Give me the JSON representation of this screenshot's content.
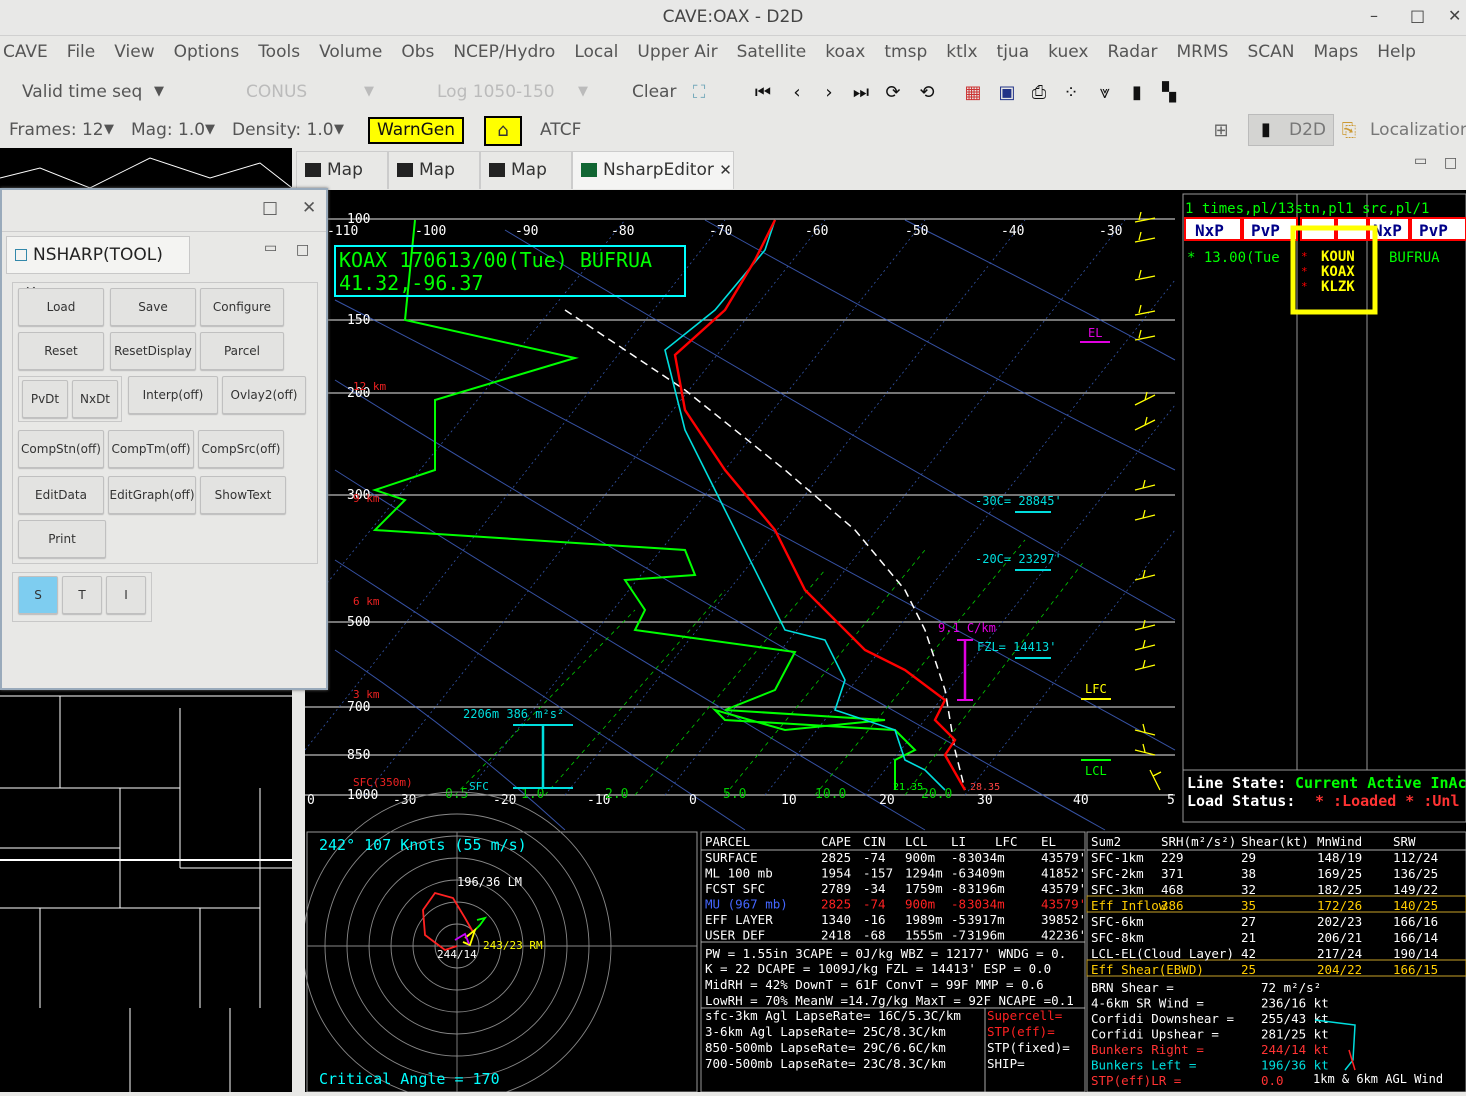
{
  "window": {
    "title": "CAVE:OAX - D2D",
    "min": "–",
    "max": "□",
    "close": "✕"
  },
  "menu": [
    "CAVE",
    "File",
    "View",
    "Options",
    "Tools",
    "Volume",
    "Obs",
    "NCEP/Hydro",
    "Local",
    "Upper Air",
    "Satellite",
    "koax",
    "tmsp",
    "ktlx",
    "tjua",
    "kuex",
    "Radar",
    "MRMS",
    "SCAN",
    "Maps",
    "Help"
  ],
  "toolbar1": {
    "valid_time": "Valid time seq",
    "conus": "CONUS",
    "log": "Log 1050-150",
    "clear": "Clear"
  },
  "toolbar2": {
    "frames": "Frames: 12",
    "mag": "Mag: 1.0",
    "density": "Density: 1.0",
    "warngen": "WarnGen",
    "atcf": "ATCF",
    "d2d": "D2D",
    "localization": "Localization"
  },
  "tabs": [
    {
      "label": "Map"
    },
    {
      "label": "Map"
    },
    {
      "label": "Map"
    },
    {
      "label": "NsharpEditor"
    }
  ],
  "tool": {
    "tab": "NSHARP(TOOL)",
    "buttons": [
      "Load",
      "Save",
      "Configure",
      "Reset",
      "ResetDisplay",
      "Parcel",
      "PvDt",
      "NxDt",
      "Interp(off)",
      "Ovlay2(off)",
      "CompStn(off)",
      "CompTm(off)",
      "CompSrc(off)",
      "EditData",
      "EditGraph(off)",
      "ShowText",
      "Print"
    ],
    "panes": [
      "S",
      "T",
      "I"
    ]
  },
  "skewt": {
    "title_line1": "KOAX 170613/00(Tue) BUFRUA",
    "title_line2": "41.32,-96.37",
    "temp_ticks": [
      "-110",
      "-100",
      "-90",
      "-80",
      "-70",
      "-60",
      "-50",
      "-40",
      "-30"
    ],
    "pressure_labels": [
      "100",
      "150",
      "200",
      "300",
      "500",
      "700",
      "850",
      "1000"
    ],
    "height_labels": [
      "12 km",
      "9 km",
      "6 km",
      "3 km",
      "SFC(350m)"
    ],
    "wind_ticks": [
      "0",
      "-30",
      "-20",
      "-10",
      "0",
      "10",
      "20",
      "30",
      "40",
      "5"
    ],
    "rh_ticks": [
      "0.5",
      "1.0",
      "2.0",
      "5.0",
      "10.0",
      "20.0"
    ],
    "annotations": {
      "el": "EL",
      "lfc": "LFC",
      "lcl": "LCL",
      "m30": "-30C= 28845'",
      "m20": "-20C= 23297'",
      "fzl": "FZL= 14413'",
      "lapse": "9.1 C/km",
      "srh": "2206m  386 m²s²",
      "sfc": "SFC",
      "t_sfc": "28.35",
      "td_sfc": "21.35"
    }
  },
  "right_panel": {
    "header": "1 times,pl/13stn,pl1 src,pl/1",
    "cols": [
      "NxP",
      "PvP",
      "NxP",
      "PvP",
      "NxP",
      "PvP"
    ],
    "time": "* 13.00(Tue",
    "stations": [
      "KOUN",
      "KOAX",
      "KLZK"
    ],
    "source": "BUFRUA",
    "line_state_label": "Line State:",
    "line_state_val": "Current Active InAc",
    "load_status_label": "Load Status:",
    "load_status_val": "* :Loaded  * :Unl"
  },
  "hodo": {
    "header": "242°  107 Knots (55 m/s)",
    "lm": "196/36 LM",
    "rm": "243/23 RM",
    "mean": "244/14",
    "crit": "Critical Angle = 170",
    "rings": [
      "20",
      "40",
      "60",
      "80",
      "100",
      "120",
      "140",
      "160"
    ]
  },
  "parcels": {
    "header": [
      "PARCEL",
      "CAPE",
      "CIN",
      "LCL",
      "LI",
      "LFC",
      "EL"
    ],
    "rows": [
      [
        "SURFACE",
        "2825",
        "-74",
        "900m",
        "-8",
        "3034m",
        "43579'"
      ],
      [
        "ML 100 mb",
        "1954",
        "-157",
        "1294m",
        "-6",
        "3409m",
        "41852'"
      ],
      [
        "FCST SFC",
        "2789",
        "-34",
        "1759m",
        "-8",
        "3196m",
        "43579'"
      ],
      [
        "MU (967 mb)",
        "2825",
        "-74",
        "900m",
        "-8",
        "3034m",
        "43579'"
      ],
      [
        "EFF LAYER",
        "1340",
        "-16",
        "1989m",
        "-5",
        "3917m",
        "39852'"
      ],
      [
        "USER DEF",
        "2418",
        "-68",
        "1555m",
        "-7",
        "3196m",
        "42236'"
      ]
    ],
    "misc": [
      "PW = 1.55in  3CAPE = 0J/kg  WBZ = 12177'  WNDG = 0.",
      "K = 22    DCAPE = 1009J/kg  FZL = 14413'  ESP = 0.0",
      "MidRH = 42%  DownT = 61F   ConvT = 99F  MMP = 0.6",
      "LowRH = 70%  MeanW =14.7g/kg  MaxT = 92F  NCAPE =0.1"
    ],
    "lapse": [
      "sfc-3km Agl  LapseRate= 16C/5.3C/km",
      "3-6km Agl  LapseRate=  25C/8.3C/km",
      "850-500mb LapseRate=  29C/6.6C/km",
      "700-500mb LapseRate=  23C/8.3C/km"
    ],
    "stp": [
      "Supercell=",
      "STP(eff)=",
      "STP(fixed)=",
      "SHIP="
    ]
  },
  "shear": {
    "header": [
      "Sum2",
      "SRH(m²/s²)",
      "Shear(kt)",
      "MnWind",
      "SRW"
    ],
    "rows": [
      [
        "SFC-1km",
        "229",
        "29",
        "148/19",
        "112/24"
      ],
      [
        "SFC-2km",
        "371",
        "38",
        "169/25",
        "136/25"
      ],
      [
        "SFC-3km",
        "468",
        "32",
        "182/25",
        "149/22"
      ],
      [
        "Eff Inflow",
        "386",
        "35",
        "172/26",
        "140/25"
      ],
      [
        "SFC-6km",
        "",
        "27",
        "202/23",
        "166/16"
      ],
      [
        "SFC-8km",
        "",
        "21",
        "206/21",
        "166/14"
      ],
      [
        "LCL-EL(Cloud Layer)",
        "",
        "42",
        "217/24",
        "190/14"
      ],
      [
        "Eff Shear(EBWD)",
        "",
        "25",
        "204/22",
        "166/15"
      ]
    ],
    "extra": [
      [
        "BRN Shear =",
        "72 m²/s²"
      ],
      [
        "4-6km SR Wind =",
        "236/16 kt"
      ],
      [
        "Corfidi Downshear =",
        "255/43 kt"
      ],
      [
        "Corfidi Upshear =",
        "281/25 kt"
      ],
      [
        "Bunkers Right =",
        "244/14 kt"
      ],
      [
        "Bunkers Left =",
        "196/36 kt"
      ],
      [
        "STP(eff)LR =",
        "0.0"
      ]
    ],
    "footer": "1km & 6km AGL Wind"
  },
  "colors": {
    "bg": "#000000",
    "temp": "#ff0000",
    "dew": "#00ff00",
    "wetbulb": "#00e5e5",
    "yellow": "#ffff00",
    "cyan": "#00ffff",
    "magenta": "#e000e0"
  }
}
